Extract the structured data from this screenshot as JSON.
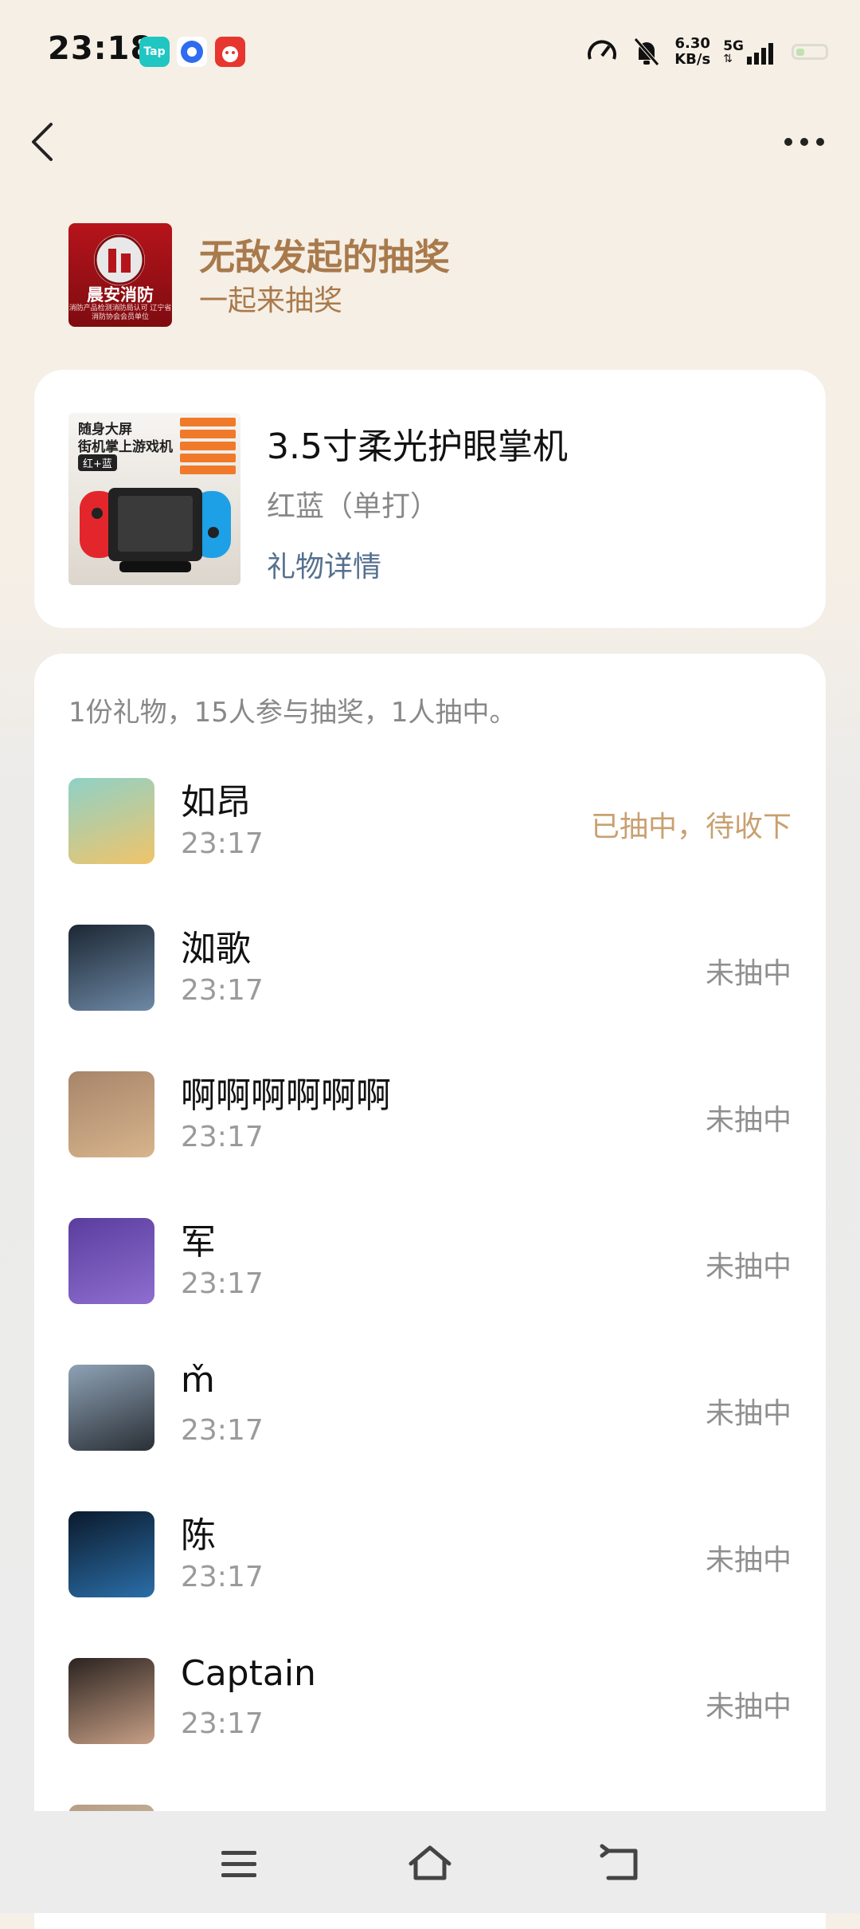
{
  "status_bar": {
    "time": "23:18",
    "apps": [
      {
        "icon": "taptap-app-icon",
        "label": "Tap",
        "color": "#1fc6c2"
      },
      {
        "icon": "blue-circle-app-icon",
        "label": "",
        "color": "#2f6cf0"
      },
      {
        "icon": "red-shopping-app-icon",
        "label": "",
        "color": "#e6362f"
      }
    ],
    "net_speed_value": "6.30",
    "net_speed_unit": "KB/s",
    "network_type": "5G"
  },
  "host": {
    "name_line": "无敌发起的抽奖",
    "subtitle": "一起来抽奖",
    "logo_text": "晨安消防",
    "logo_subtext": "消防产品检测消防局认可 辽宁省消防协会会员单位"
  },
  "gift": {
    "name": "3.5寸柔光护眼掌机",
    "variant": "红蓝（单打）",
    "details_link": "礼物详情",
    "image_caption_1": "随身大屏",
    "image_caption_2": "街机掌上游戏机",
    "image_badge": "红+蓝"
  },
  "draw": {
    "summary": "1份礼物，15人参与抽奖，1人抽中。",
    "entries": [
      {
        "name": "如昂",
        "time": "23:17",
        "status": "已抽中，待收下",
        "won": true,
        "avatar_colors": [
          "#8fd1c7",
          "#f0c46a"
        ]
      },
      {
        "name": "洳歌",
        "time": "23:17",
        "status": "未抽中",
        "won": false,
        "avatar_colors": [
          "#1c2733",
          "#6e89a6"
        ]
      },
      {
        "name": "啊啊啊啊啊啊",
        "time": "23:17",
        "status": "未抽中",
        "won": false,
        "avatar_colors": [
          "#a7856a",
          "#d8b48c"
        ]
      },
      {
        "name": "军",
        "time": "23:17",
        "status": "未抽中",
        "won": false,
        "avatar_colors": [
          "#5a3d9e",
          "#8e6fd0"
        ]
      },
      {
        "name": "m̌",
        "time": "23:17",
        "status": "未抽中",
        "won": false,
        "avatar_colors": [
          "#8ea2b6",
          "#2a2f35"
        ]
      },
      {
        "name": "陈",
        "time": "23:17",
        "status": "未抽中",
        "won": false,
        "avatar_colors": [
          "#0b1a2c",
          "#2b6ea8"
        ]
      },
      {
        "name": "Captain",
        "time": "23:17",
        "status": "未抽中",
        "won": false,
        "avatar_colors": [
          "#2b2320",
          "#c79f86"
        ]
      },
      {
        "name": "",
        "time": "",
        "status": "",
        "won": false,
        "avatar_colors": [
          "#b59d85",
          "#d9c6b2"
        ]
      }
    ]
  },
  "colors": {
    "accent_gold": "#a87a4c",
    "won_status": "#c9a070",
    "link_blue": "#55708f"
  }
}
